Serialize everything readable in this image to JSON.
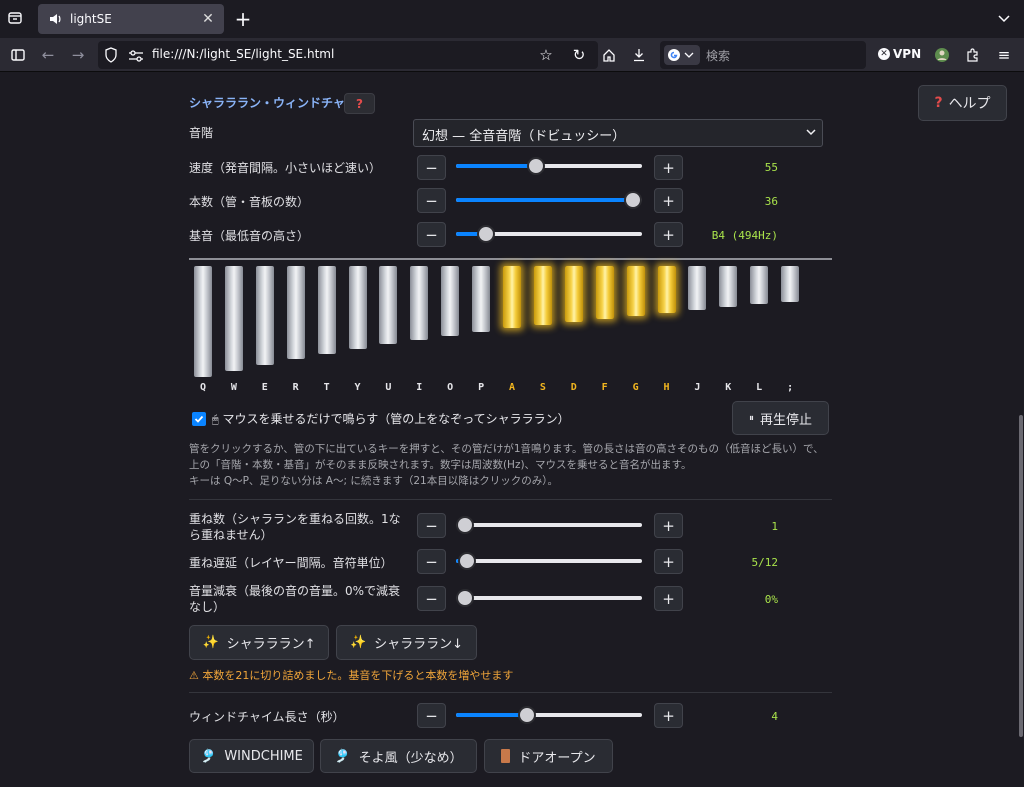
{
  "browser": {
    "tab_title": "lightSE",
    "url": "file:///N:/light_SE/light_SE.html",
    "search_placeholder": "検索",
    "vpn_label": "VPN"
  },
  "section": {
    "title": "シャラララン・ウィンドチャイム",
    "q_mark": "?",
    "help_label": "ヘルプ"
  },
  "scale": {
    "label": "音階",
    "selected": "幻想 — 全音音階（ドビュッシー）"
  },
  "controls": {
    "speed": {
      "label": "速度（発音間隔。小さいほど速い）",
      "value_text": "55",
      "fraction": 0.43
    },
    "count": {
      "label": "本数（管・音板の数）",
      "value_text": "36",
      "fraction": 0.96
    },
    "base": {
      "label": "基音（最低音の高さ）",
      "value_text": "B4 (494Hz)",
      "fraction": 0.16
    }
  },
  "chimes": {
    "keys": [
      "Q",
      "W",
      "E",
      "R",
      "T",
      "Y",
      "U",
      "I",
      "O",
      "P",
      "A",
      "S",
      "D",
      "F",
      "G",
      "H",
      "J",
      "K",
      "L",
      ";"
    ],
    "lengths": [
      111,
      105,
      99,
      93,
      88,
      83,
      78,
      74,
      70,
      66,
      62,
      59,
      56,
      53,
      50,
      47,
      44,
      41,
      38,
      36
    ],
    "lit": [
      false,
      false,
      false,
      false,
      false,
      false,
      false,
      false,
      false,
      false,
      true,
      true,
      true,
      true,
      true,
      true,
      false,
      false,
      false,
      false
    ]
  },
  "hover": {
    "checked": true,
    "label": "マウスを乗せるだけで鳴らす（管の上をなぞってシャラララン）",
    "play_stop_label": "再生停止"
  },
  "description": {
    "line1": "管をクリックするか、管の下に出ているキーを押すと、その管だけが1音鳴ります。管の長さは音の高さそのもの（低音ほど長い）で、上の「音階・本数・基音」がそのまま反映されます。数字は周波数(Hz)、マウスを乗せると音名が出ます。",
    "line2": "キーは Q〜P、足りない分は A〜; に続きます（21本目以降はクリックのみ）。"
  },
  "layers": {
    "repeat": {
      "label": "重ね数（シャラランを重ねる回数。1なら重ねません）",
      "value_text": "1",
      "fraction": 0.0
    },
    "delay": {
      "label": "重ね遅延（レイヤー間隔。音符単位）",
      "value_text": "5/12",
      "fraction": 0.06
    },
    "decay": {
      "label": "音量減衰（最後の音の音量。0%で減衰なし）",
      "value_text": "0%",
      "fraction": 0.0
    }
  },
  "effects": {
    "up_label": "シャラララン↑",
    "down_label": "シャラララン↓",
    "warning": "⚠ 本数を21に切り詰めました。基音を下げると本数を増やせます"
  },
  "windchime": {
    "length_label": "ウィンドチャイム長さ（秒）",
    "value_text": "4",
    "fraction": 0.38,
    "buttons": [
      "WINDCHIME",
      "そよ風（少なめ）",
      "ドアオープン"
    ]
  },
  "colors": {
    "accent": "#0a84ff",
    "lit": "#f7d34a",
    "value": "#a9e34b",
    "warning": "#f0a53a"
  }
}
